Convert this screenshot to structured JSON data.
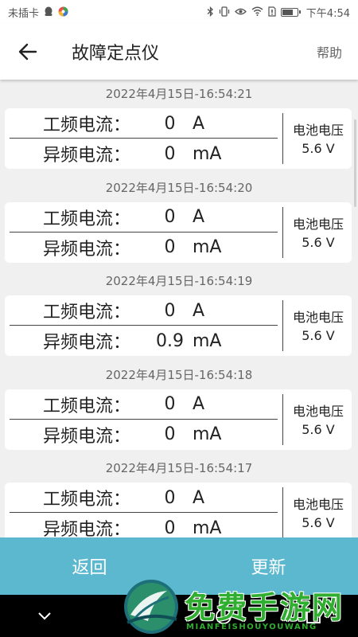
{
  "status_bar": {
    "carrier": "未插卡",
    "time": "下午4:54",
    "battery_level": 0.75,
    "icons": [
      "qq-icon",
      "wheel-icon",
      "bluetooth-icon",
      "vibrate-icon",
      "eye-icon",
      "wifi-icon",
      "sim-icon",
      "battery-icon"
    ]
  },
  "app_bar": {
    "title": "故障定点仪",
    "help": "帮助",
    "back_icon": "arrow-left-icon"
  },
  "labels": {
    "power_freq": "工频电流：",
    "abnormal_freq": "异频电流：",
    "battery": "电池电压"
  },
  "records": [
    {
      "timestamp": "2022年4月15日-16:54:21",
      "power_value": "0",
      "power_unit": "A",
      "abnormal_value": "0",
      "abnormal_unit": "mA",
      "battery_voltage": "5.6 V"
    },
    {
      "timestamp": "2022年4月15日-16:54:20",
      "power_value": "0",
      "power_unit": "A",
      "abnormal_value": "0",
      "abnormal_unit": "mA",
      "battery_voltage": "5.6 V"
    },
    {
      "timestamp": "2022年4月15日-16:54:19",
      "power_value": "0",
      "power_unit": "A",
      "abnormal_value": "0.9",
      "abnormal_unit": "mA",
      "battery_voltage": "5.6 V"
    },
    {
      "timestamp": "2022年4月15日-16:54:18",
      "power_value": "0",
      "power_unit": "A",
      "abnormal_value": "0",
      "abnormal_unit": "mA",
      "battery_voltage": "5.6 V"
    },
    {
      "timestamp": "2022年4月15日-16:54:17",
      "power_value": "0",
      "power_unit": "A",
      "abnormal_value": "0",
      "abnormal_unit": "mA",
      "battery_voltage": "5.6 V"
    }
  ],
  "actions": {
    "back": "返回",
    "refresh": "更新"
  },
  "nav": [
    "chevron-down-icon",
    "back-triangle-icon",
    "home-circle-icon",
    "recents-square-icon"
  ],
  "watermark": {
    "text": "免费手游网",
    "sub": "MIANFEISHOUYOUWANG"
  },
  "colors": {
    "action_bar": "#5bb8cf",
    "watermark": "#2fae2f"
  }
}
